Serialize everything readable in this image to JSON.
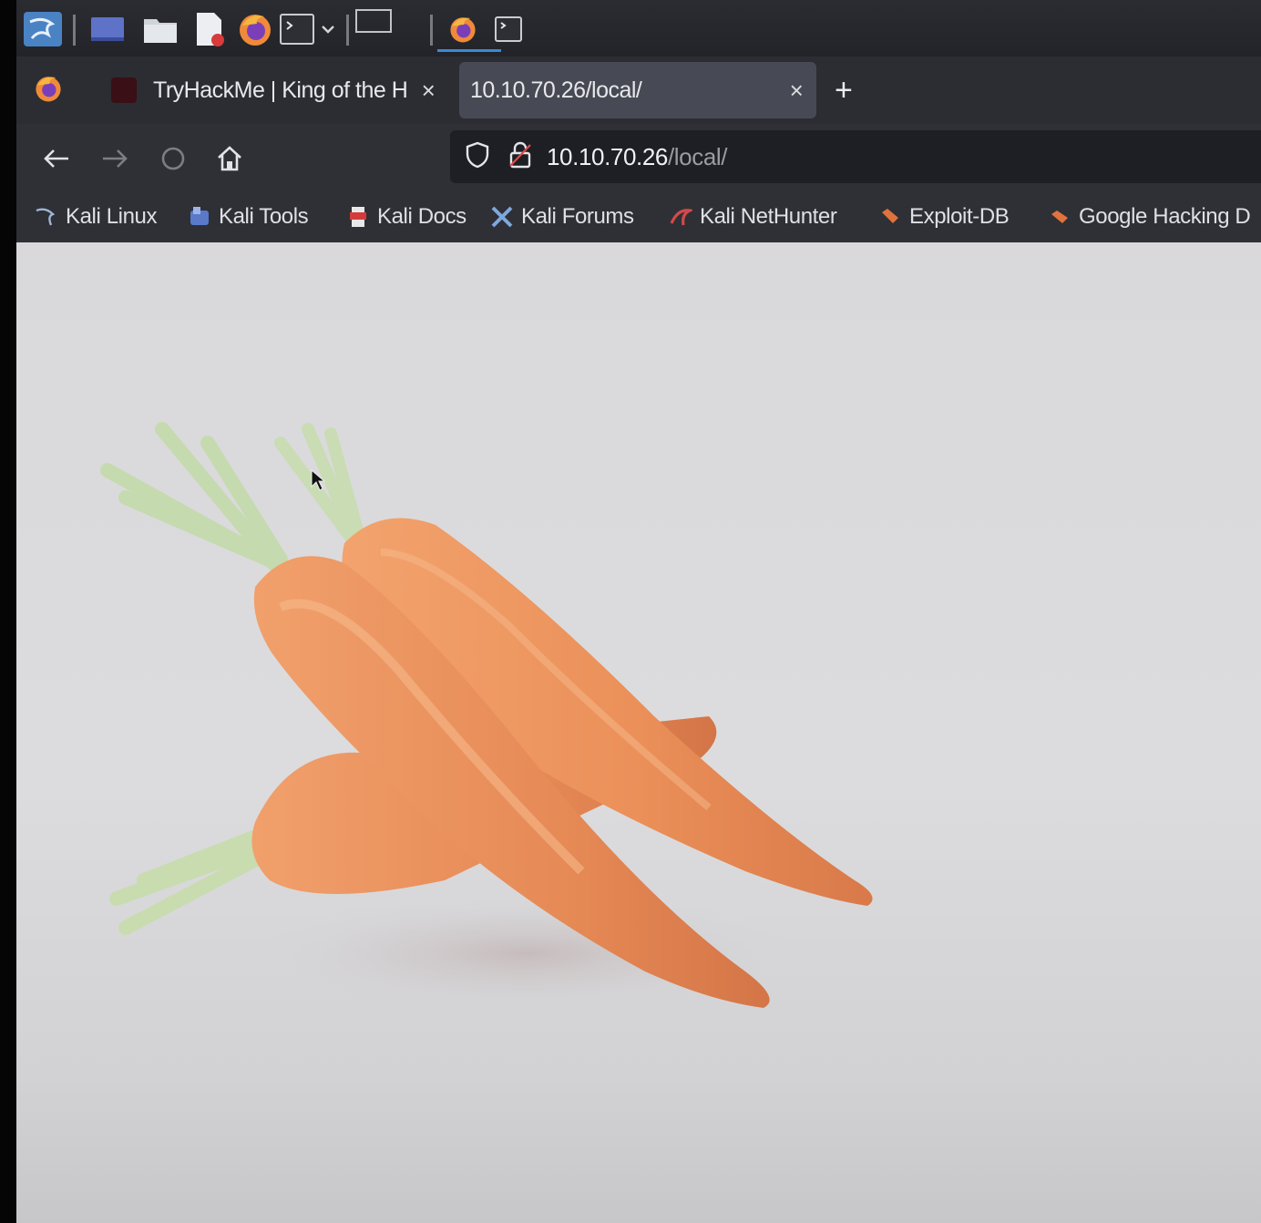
{
  "taskbar": {
    "icons": [
      "kali-menu-icon",
      "desktop-icon",
      "folder-icon",
      "text-editor-icon",
      "firefox-icon",
      "terminal-icon",
      "workspace-icon",
      "firefox-window-icon",
      "terminal-window-icon"
    ]
  },
  "tabs": [
    {
      "label": "TryHackMe | King of the H",
      "close": "×",
      "active": false
    },
    {
      "label": "10.10.70.26/local/",
      "close": "×",
      "active": true
    }
  ],
  "new_tab": "+",
  "url": {
    "host": "10.10.70.26",
    "path": "/local/"
  },
  "bookmarks": [
    {
      "label": "Kali Linux",
      "icon": "kali-linux-icon",
      "color": "#3a6ea8"
    },
    {
      "label": "Kali Tools",
      "icon": "kali-tools-icon",
      "color": "#5b79c9"
    },
    {
      "label": "Kali Docs",
      "icon": "kali-docs-icon",
      "color": "#d43a3a"
    },
    {
      "label": "Kali Forums",
      "icon": "kali-forums-icon",
      "color": "#5f8fd0"
    },
    {
      "label": "Kali NetHunter",
      "icon": "kali-nethunter-icon",
      "color": "#d14949"
    },
    {
      "label": "Exploit-DB",
      "icon": "exploit-db-icon",
      "color": "#e0733c"
    },
    {
      "label": "Google Hacking D",
      "icon": "google-hacking-icon",
      "color": "#e0733c"
    }
  ],
  "page": {
    "image": "carrots-photo"
  }
}
